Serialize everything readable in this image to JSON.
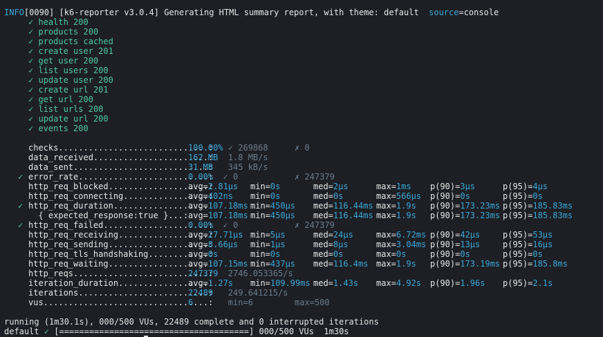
{
  "header": {
    "level": "INFO",
    "code": "[0090]",
    "message": " [k6-reporter v3.0.4] Generating HTML summary report, with theme: default  ",
    "source_key": "source",
    "source_val": "=console"
  },
  "check_mark": "✓",
  "cross_mark": "✗",
  "checks_list": [
    "health 200",
    "products 200",
    "products cached",
    "create user 201",
    "get user 200",
    "list users 200",
    "update user 200",
    "create url 201",
    "get url 200",
    "list urls 200",
    "update url 200",
    "events 200"
  ],
  "metrics": [
    {
      "mark": "",
      "name": "checks..............................:",
      "c1": "100.00%",
      "c1_dim": " ✓ 269868",
      "c3": "✗ 0"
    },
    {
      "mark": "",
      "name": "data_received.......................:",
      "c1": "162 MB",
      "c1_dim": "  1.8 MB/s"
    },
    {
      "mark": "",
      "name": "data_sent...........................:",
      "c1": "31 MB",
      "c1_dim": "   345 kB/s"
    },
    {
      "mark": "✓",
      "name": "error_rate..........................:",
      "c1": "0.00%",
      "c1_dim": "  ✓ 0",
      "c3": "✗ 247379"
    },
    {
      "mark": "",
      "name": "http_req_blocked....................:",
      "avg": "2.81µs",
      "min": "0s",
      "med": "2µs",
      "max": "1ms",
      "p90": "3µs",
      "p95": "4µs"
    },
    {
      "mark": "",
      "name": "http_req_connecting.................:",
      "avg": "402ns",
      "min": "0s",
      "med": "0s",
      "max": "566µs",
      "p90": "0s",
      "p95": "0s"
    },
    {
      "mark": "✓",
      "name": "http_req_duration...................:",
      "avg": "107.18ms",
      "min": "450µs",
      "med": "116.44ms",
      "max": "1.9s",
      "p90": "173.23ms",
      "p95": "185.83ms"
    },
    {
      "mark": "",
      "name": "  { expected_response:true }...:",
      "avg": "107.18ms",
      "min": "450µs",
      "med": "116.44ms",
      "max": "1.9s",
      "p90": "173.23ms",
      "p95": "185.83ms"
    },
    {
      "mark": "✓",
      "name": "http_req_failed.....................:",
      "c1": "0.00%",
      "c1_dim": "  ✓ 0",
      "c3": "✗ 247379"
    },
    {
      "mark": "",
      "name": "http_req_receiving..................:",
      "avg": "27.71µs",
      "min": "5µs",
      "med": "24µs",
      "max": "6.72ms",
      "p90": "42µs",
      "p95": "53µs"
    },
    {
      "mark": "",
      "name": "http_req_sending....................:",
      "avg": "8.66µs",
      "min": "1µs",
      "med": "8µs",
      "max": "3.04ms",
      "p90": "13µs",
      "p95": "16µs"
    },
    {
      "mark": "",
      "name": "http_req_tls_handshaking............:",
      "avg": "0s",
      "min": "0s",
      "med": "0s",
      "max": "0s",
      "p90": "0s",
      "p95": "0s"
    },
    {
      "mark": "",
      "name": "http_req_waiting....................:",
      "avg": "107.15ms",
      "min": "437µs",
      "med": "116.4ms",
      "max": "1.9s",
      "p90": "173.19ms",
      "p95": "185.8ms"
    },
    {
      "mark": "",
      "name": "http_reqs...........................:",
      "c1": "247379",
      "c1_dim": "  2746.053365/s"
    },
    {
      "mark": "",
      "name": "iteration_duration..................:",
      "avg": "1.27s",
      "min": "109.99ms",
      "med": "1.43s",
      "max": "4.92s",
      "p90": "1.96s",
      "p95": "2.1s"
    },
    {
      "mark": "",
      "name": "iterations..........................:",
      "c1": "22489",
      "c1_dim": "   249.641215/s"
    },
    {
      "mark": "",
      "name": "vus.................................:",
      "c1": "6",
      "c1_dim": "       min=6",
      "c3": "max=500"
    }
  ],
  "footer": {
    "running": "running (1m30.1s), 000/500 VUs, 22489 complete and 0 interrupted iterations",
    "default_label": "default ",
    "default_check": "✓",
    "bar": " [======================================] ",
    "tail": "000/500 VUs  1m30s"
  }
}
